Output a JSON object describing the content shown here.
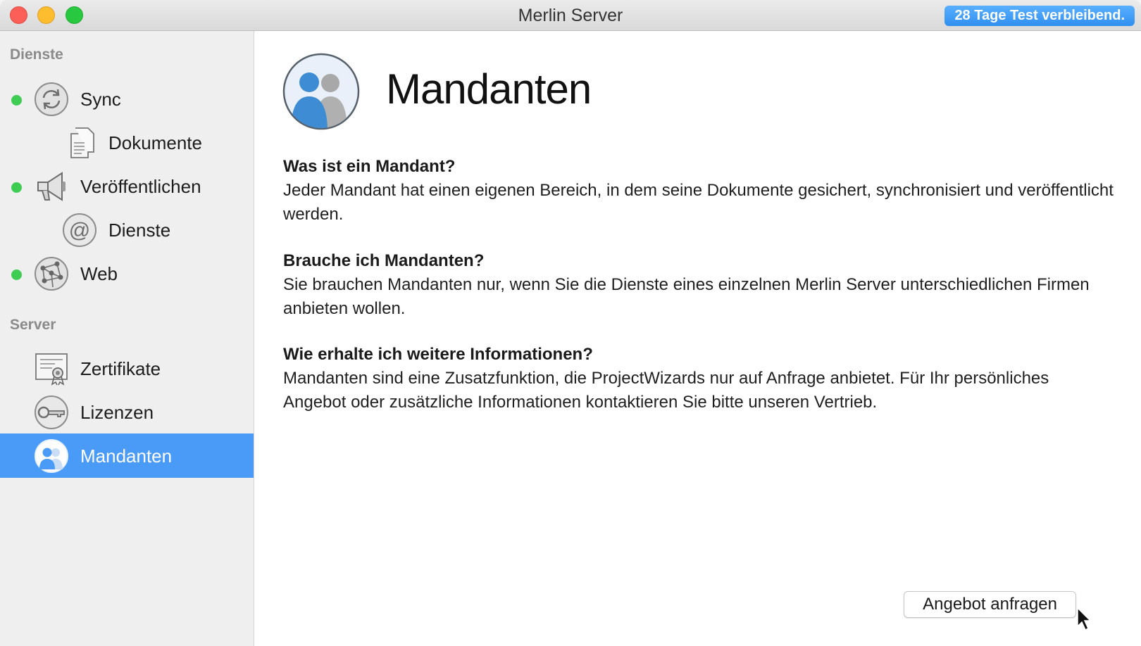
{
  "window": {
    "title": "Merlin Server",
    "trial_badge": "28 Tage Test verbleibend."
  },
  "sidebar": {
    "sections": [
      {
        "title": "Dienste"
      },
      {
        "title": "Server"
      }
    ],
    "items": [
      {
        "label": "Sync",
        "icon": "sync-icon",
        "status": "active"
      },
      {
        "label": "Dokumente",
        "icon": "document-icon"
      },
      {
        "label": "Veröffentlichen",
        "icon": "megaphone-icon",
        "status": "active"
      },
      {
        "label": "Dienste",
        "icon": "at-sign-icon"
      },
      {
        "label": "Web",
        "icon": "network-globe-icon",
        "status": "active"
      },
      {
        "label": "Zertifikate",
        "icon": "certificate-icon"
      },
      {
        "label": "Lizenzen",
        "icon": "key-icon"
      },
      {
        "label": "Mandanten",
        "icon": "users-icon",
        "selected": true
      }
    ]
  },
  "main": {
    "title": "Mandanten",
    "icon": "users-icon",
    "faq": [
      {
        "question": "Was ist ein Mandant?",
        "answer": "Jeder Mandant hat einen eigenen Bereich, in dem seine Dokumente gesichert, synchronisiert und veröffentlicht werden."
      },
      {
        "question": "Brauche ich Mandanten?",
        "answer": "Sie brauchen Mandanten nur, wenn Sie die Dienste eines einzelnen Merlin Server unterschiedlichen Firmen anbieten wollen."
      },
      {
        "question": "Wie erhalte ich weitere Informationen?",
        "answer": "Mandanten sind eine Zusatzfunktion, die ProjectWizards nur auf Anfrage anbietet. Für Ihr persönliches Angebot oder zusätzliche Informationen kontaktieren Sie bitte unseren Vertrieb."
      }
    ],
    "action_button": "Angebot anfragen"
  },
  "colors": {
    "selection": "#4a9bf7",
    "status_active": "#3ecc52",
    "badge": "#2f8fef"
  }
}
